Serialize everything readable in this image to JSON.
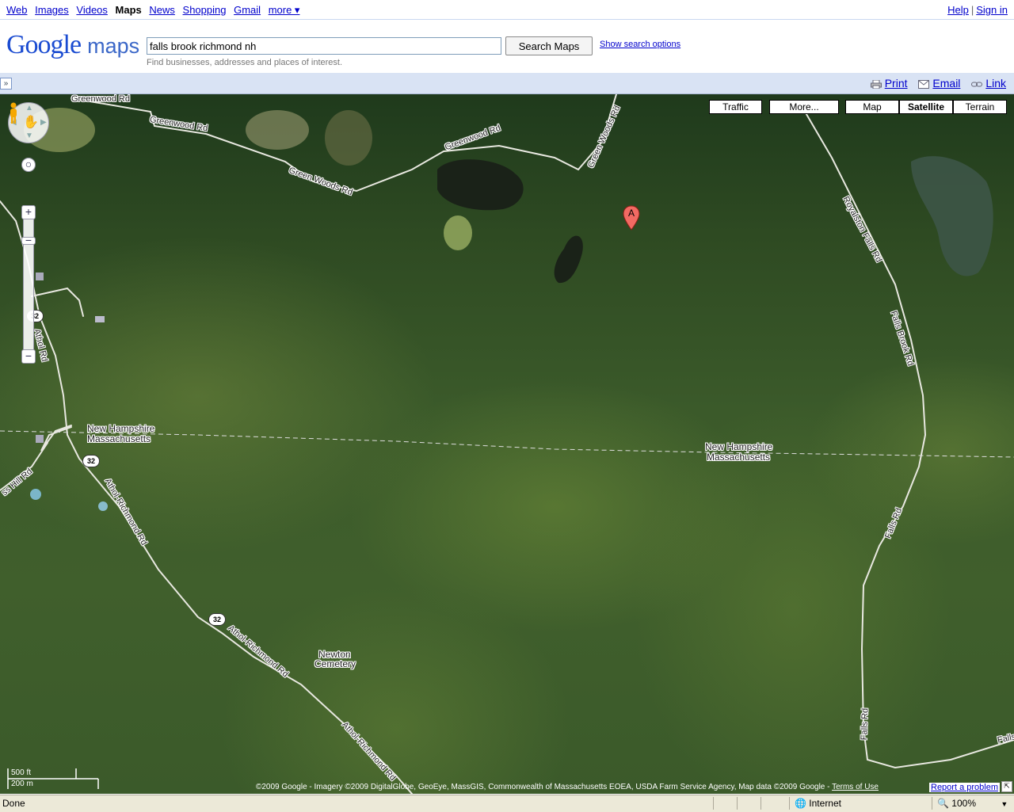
{
  "top_nav": {
    "links": [
      "Web",
      "Images",
      "Videos",
      "Maps",
      "News",
      "Shopping",
      "Gmail",
      "more ▾"
    ],
    "help": "Help",
    "separator": "|",
    "sign_in": "Sign in"
  },
  "header": {
    "logo_google": "Google",
    "logo_maps": "maps",
    "search_value": "falls brook richmond nh",
    "search_button": "Search Maps",
    "show_options": "Show search options",
    "hint": "Find businesses, addresses and places of interest."
  },
  "bar": {
    "toggle": "»",
    "print": "Print",
    "email": "Email",
    "link": "Link"
  },
  "map": {
    "buttons": {
      "traffic": "Traffic",
      "more": "More...",
      "map": "Map",
      "satellite": "Satellite",
      "terrain": "Terrain"
    },
    "selected_type": "Satellite",
    "marker_label": "A",
    "roads": {
      "greenwood_1": "Greenwood Rd",
      "greenwood_2": "Greenwood Rd",
      "green_woods_1": "Green Woods Rd",
      "green_woods_2": "Green Woods Rd",
      "royalston": "Royalston Falls Rd",
      "falls_brook": "Falls Brook Rd",
      "falls_1": "Falls Rd",
      "falls_2": "Falls Rd",
      "falls_3": "Falls",
      "athol": "Athol Rd",
      "athol_richmond_1": "Athol-Richmond Rd",
      "athol_richmond_2": "Athol-Richmond Rd",
      "athol_richmond_3": "Athol-Richmond Rd",
      "hill": "ss Hill Rd"
    },
    "shields": [
      "32",
      "32",
      "32"
    ],
    "states": {
      "nh": "New Hampshire",
      "ma": "Massachusetts"
    },
    "cemetery": [
      "Newton",
      "Cemetery"
    ],
    "scale": {
      "ft": "500 ft",
      "m": "200 m"
    },
    "attribution": "©2009 Google - Imagery ©2009 DigitalGlobe, GeoEye, MassGIS, Commonwealth of Massachusetts EOEA, USDA Farm Service Agency, Map data ©2009 Google - ",
    "terms": "Terms of Use",
    "report": "Report a problem"
  },
  "status_bar": {
    "left": "Done",
    "zone": "Internet",
    "zoom": "100%"
  }
}
